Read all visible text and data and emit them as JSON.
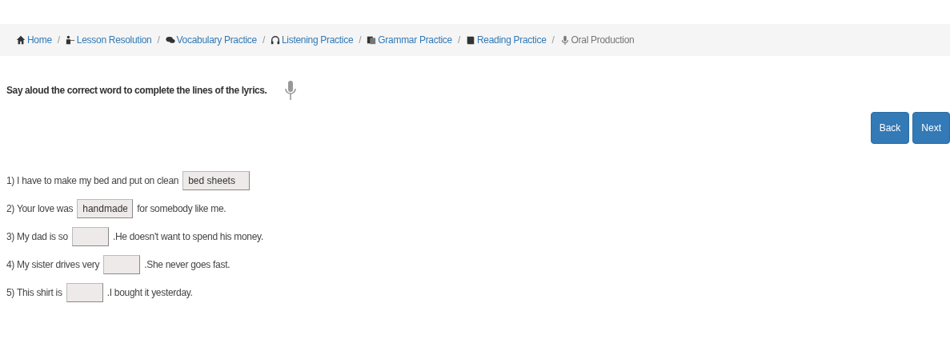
{
  "breadcrumb": [
    {
      "label": "Home",
      "active": false
    },
    {
      "label": "Lesson Resolution",
      "active": false
    },
    {
      "label": "Vocabulary Practice",
      "active": false
    },
    {
      "label": "Listening Practice",
      "active": false
    },
    {
      "label": "Grammar Practice",
      "active": false
    },
    {
      "label": "Reading Practice",
      "active": false
    },
    {
      "label": "Oral Production",
      "active": true
    }
  ],
  "separators": [
    "/",
    "/",
    "/",
    "/",
    "/",
    "/"
  ],
  "instruction": "Say aloud the correct word to complete the lines of the lyrics.",
  "buttons": [
    "Back",
    "Next"
  ],
  "exercises": [
    {
      "prefix": "1) I have to make my bed and put on clean",
      "answer": "bed sheets"
    },
    {
      "prefix": "2) Your love was",
      "answer": "handmade",
      "suffix": "for somebody like me."
    },
    {
      "prefix": "3) My dad is so",
      "suffix": ".He doesn't want to spend his money."
    },
    {
      "prefix": "4) My sister drives very",
      "suffix": ".She never goes fast."
    },
    {
      "prefix": "5) This shirt is",
      "suffix": ".I bought it yesterday."
    }
  ]
}
